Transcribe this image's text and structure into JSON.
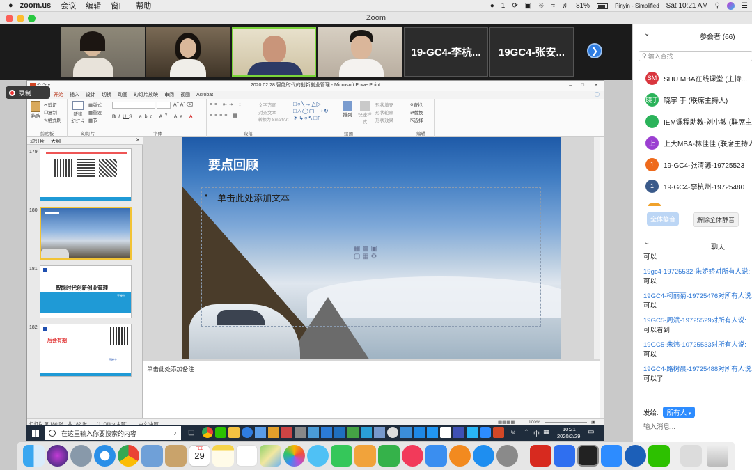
{
  "menubar": {
    "app": "zoom.us",
    "items": [
      "会议",
      "编辑",
      "窗口",
      "帮助"
    ],
    "wechat_badge": "1",
    "battery": "81%",
    "input_method": "Pinyin - Simplified",
    "clock": "Sat 10:21 AM"
  },
  "window": {
    "title": "Zoom"
  },
  "video": {
    "name_tiles": [
      "19-GC4-李杭...",
      "19GC4-张安..."
    ]
  },
  "recording": {
    "label": "录制..."
  },
  "participants": {
    "title": "参会者 (66)",
    "search_placeholder": "输入查找",
    "list": [
      {
        "initials": "SM",
        "name": "SHU MBA在线课堂 (主持...",
        "color": "#d9363e"
      },
      {
        "initials": "晓于",
        "name": "晓宇 于 (联席主持人)",
        "color": "#2bb35a"
      },
      {
        "initials": "I",
        "name": "IEM课程助教-刘小敏 (联席主",
        "color": "#2bb35a"
      },
      {
        "initials": "上",
        "name": "上大MBA-林佳佳 (联席主持人",
        "color": "#9b3fd1"
      },
      {
        "initials": "1",
        "name": "19-GC4-张清源-19725523",
        "color": "#ee6a1c"
      },
      {
        "initials": "1",
        "name": "19-GC4-李杭州-19725480",
        "color": "#3a5a8a"
      }
    ],
    "mute_all": "全体静音",
    "unmute_all": "解除全体静音"
  },
  "chat": {
    "title": "聊天",
    "messages": [
      {
        "who": "",
        "to": "",
        "text": "可以"
      },
      {
        "who": "19gc4-19725532-朱娇娇",
        "to": "对所有人说:",
        "text": "可以"
      },
      {
        "who": "19GC4-柯丽菊-19725476",
        "to": "对所有人说:",
        "text": "可以"
      },
      {
        "who": "19GC5-周斌-19725529",
        "to": "对所有人说:",
        "text": "可以看到"
      },
      {
        "who": "19GC5-朱炜-10725533",
        "to": "对所有人说:",
        "text": "可以"
      },
      {
        "who": "19GC4-路树晨-19725488",
        "to": "对所有人说:",
        "text": "可以了"
      }
    ],
    "send_to_label": "发给:",
    "send_to_value": "所有人",
    "input_placeholder": "输入消息..."
  },
  "ppt": {
    "title": "2020 02 28 智能时代的创新创业管理 - Microsoft PowerPoint",
    "tabs": [
      "开始",
      "插入",
      "设计",
      "切换",
      "动画",
      "幻灯片放映",
      "审阅",
      "视图",
      "Acrobat"
    ],
    "groups": {
      "clipboard": {
        "label": "剪贴板",
        "paste": "粘贴",
        "cut": "剪切",
        "copy": "复制",
        "format": "格式刷"
      },
      "slides": {
        "label": "幻灯片",
        "new": "新建",
        "new2": "幻灯片",
        "layout": "版式",
        "reset": "重设",
        "section": "节"
      },
      "font": {
        "label": "字体"
      },
      "paragraph": {
        "label": "段落",
        "text_dir": "文字方向",
        "align": "对齐文本",
        "smartart": "转换为 SmartArt"
      },
      "drawing": {
        "label": "绘图",
        "arrange": "排列",
        "quick": "快速样式",
        "fill": "形状填充",
        "outline": "形状轮廓",
        "effect": "形状效果"
      },
      "editing": {
        "label": "编辑",
        "find": "查找",
        "replace": "替换",
        "select": "选择"
      }
    },
    "panel_tabs": [
      "幻灯片",
      "大纲"
    ],
    "thumbs": [
      {
        "num": "179"
      },
      {
        "num": "180"
      },
      {
        "num": "181",
        "title": "智能时代创新创业管理",
        "author": "于晓宇"
      },
      {
        "num": "182",
        "title": "后会有期",
        "author": "于晓宇"
      }
    ],
    "slide": {
      "title": "要点回顾",
      "bullet": "单击此处添加文本"
    },
    "notes_placeholder": "单击此处添加备注",
    "status": {
      "slide": "幻灯片 第 180 张，共 182 张",
      "theme": "\"1_Office 主题\"",
      "lang": "中文(中国)",
      "zoom": "100%"
    }
  },
  "taskbar": {
    "search_placeholder": "在这里输入你要搜索的内容",
    "time": "10:21",
    "date": "2020/2/29",
    "ime": "中"
  },
  "dock": {
    "calendar_day": "29",
    "calendar_month": "FEB"
  }
}
